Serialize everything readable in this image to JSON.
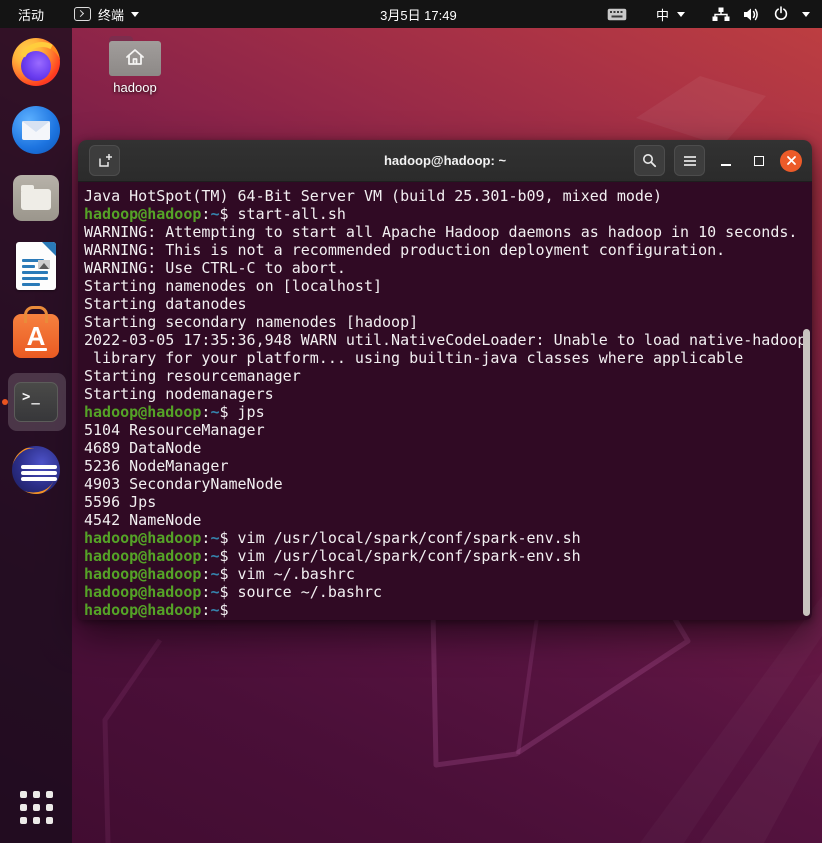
{
  "top_bar": {
    "activities": "活动",
    "app_name": "终端",
    "clock": "3月5日 17:49",
    "input_method": "中"
  },
  "desktop": {
    "folder_label": "hadoop"
  },
  "dock": {
    "items": [
      "Firefox",
      "Thunderbird",
      "Files",
      "LibreOffice Writer",
      "Ubuntu Software",
      "Terminal",
      "Eclipse",
      "Show Applications"
    ],
    "running_app": "Terminal"
  },
  "window": {
    "title": "hadoop@hadoop: ~"
  },
  "terminal": {
    "lines": [
      [
        [
          "t",
          "Java HotSpot(TM) 64-Bit Server VM (build 25.301-b09, mixed mode)"
        ]
      ],
      [
        [
          "u",
          "hadoop@hadoop"
        ],
        [
          "t",
          ":"
        ],
        [
          "p",
          "~"
        ],
        [
          "t",
          "$ start-all.sh"
        ]
      ],
      [
        [
          "t",
          "WARNING: Attempting to start all Apache Hadoop daemons as hadoop in 10 seconds."
        ]
      ],
      [
        [
          "t",
          "WARNING: This is not a recommended production deployment configuration."
        ]
      ],
      [
        [
          "t",
          "WARNING: Use CTRL-C to abort."
        ]
      ],
      [
        [
          "t",
          "Starting namenodes on [localhost]"
        ]
      ],
      [
        [
          "t",
          "Starting datanodes"
        ]
      ],
      [
        [
          "t",
          "Starting secondary namenodes [hadoop]"
        ]
      ],
      [
        [
          "t",
          "2022-03-05 17:35:36,948 WARN util.NativeCodeLoader: Unable to load native-hadoop"
        ]
      ],
      [
        [
          "t",
          " library for your platform... using builtin-java classes where applicable"
        ]
      ],
      [
        [
          "t",
          "Starting resourcemanager"
        ]
      ],
      [
        [
          "t",
          "Starting nodemanagers"
        ]
      ],
      [
        [
          "u",
          "hadoop@hadoop"
        ],
        [
          "t",
          ":"
        ],
        [
          "p",
          "~"
        ],
        [
          "t",
          "$ jps"
        ]
      ],
      [
        [
          "t",
          "5104 ResourceManager"
        ]
      ],
      [
        [
          "t",
          "4689 DataNode"
        ]
      ],
      [
        [
          "t",
          "5236 NodeManager"
        ]
      ],
      [
        [
          "t",
          "4903 SecondaryNameNode"
        ]
      ],
      [
        [
          "t",
          "5596 Jps"
        ]
      ],
      [
        [
          "t",
          "4542 NameNode"
        ]
      ],
      [
        [
          "u",
          "hadoop@hadoop"
        ],
        [
          "t",
          ":"
        ],
        [
          "p",
          "~"
        ],
        [
          "t",
          "$ vim /usr/local/spark/conf/spark-env.sh"
        ]
      ],
      [
        [
          "u",
          "hadoop@hadoop"
        ],
        [
          "t",
          ":"
        ],
        [
          "p",
          "~"
        ],
        [
          "t",
          "$ vim /usr/local/spark/conf/spark-env.sh"
        ]
      ],
      [
        [
          "u",
          "hadoop@hadoop"
        ],
        [
          "t",
          ":"
        ],
        [
          "p",
          "~"
        ],
        [
          "t",
          "$ vim ~/.bashrc"
        ]
      ],
      [
        [
          "u",
          "hadoop@hadoop"
        ],
        [
          "t",
          ":"
        ],
        [
          "p",
          "~"
        ],
        [
          "t",
          "$ source ~/.bashrc"
        ]
      ],
      [
        [
          "u",
          "hadoop@hadoop"
        ],
        [
          "t",
          ":"
        ],
        [
          "p",
          "~"
        ],
        [
          "t",
          "$ "
        ]
      ]
    ]
  },
  "colors": {
    "accent_orange": "#e95420",
    "prompt_green": "#55a327",
    "prompt_blue": "#3584ad",
    "terminal_bg": "#300a24",
    "topbar_bg": "#141414"
  }
}
